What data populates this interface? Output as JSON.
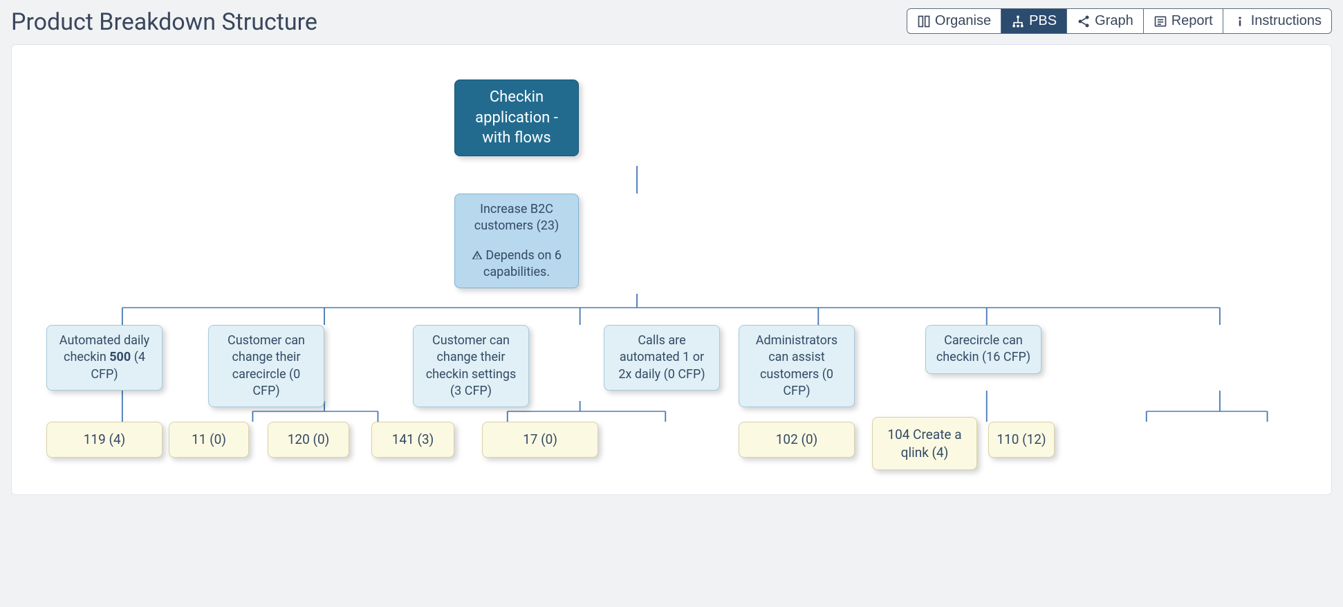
{
  "title": "Product Breakdown Structure",
  "toolbar": {
    "organise": "Organise",
    "pbs": "PBS",
    "graph": "Graph",
    "report": "Report",
    "instructions": "Instructions"
  },
  "root": {
    "label": "Checkin application - with flows"
  },
  "goal": {
    "label": "Increase B2C customers (23)",
    "warn": "Depends on 6 capabilities."
  },
  "caps": [
    {
      "prefix": "Automated daily checkin",
      "bold": "500",
      "suffix": " (4 CFP)"
    },
    {
      "label": "Customer can change their carecircle (0 CFP)"
    },
    {
      "label": "Customer can change their checkin settings (3 CFP)"
    },
    {
      "label": "Calls are automated 1 or 2x daily (0 CFP)"
    },
    {
      "label": "Administrators can assist customers (0 CFP)"
    },
    {
      "label": "Carecircle can checkin (16 CFP)"
    }
  ],
  "leaves": [
    {
      "label": "119 (4)"
    },
    {
      "label": "11 (0)"
    },
    {
      "label": "120 (0)"
    },
    {
      "label": "141 (3)"
    },
    {
      "label": "17 (0)"
    },
    {
      "label": "102 (0)"
    },
    {
      "label": "104 Create a qlink (4)"
    },
    {
      "label": "110 (12)"
    }
  ]
}
